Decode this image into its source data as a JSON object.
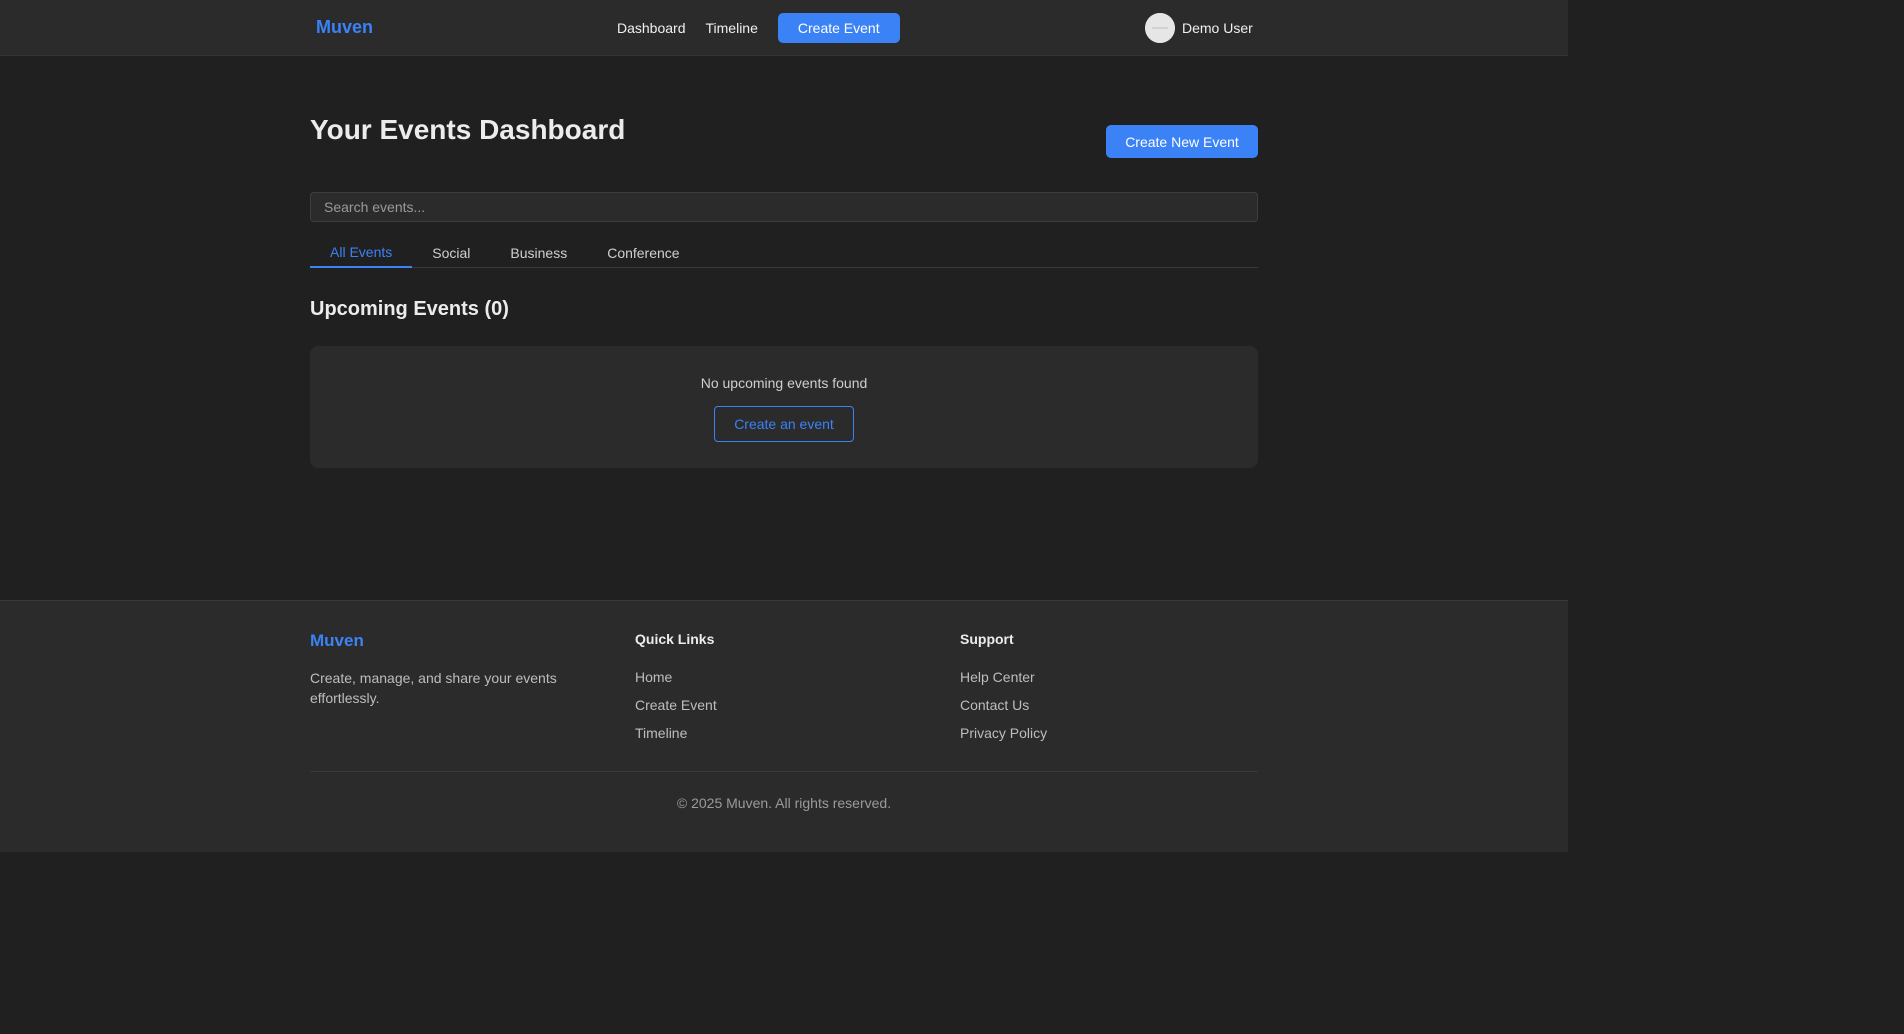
{
  "navbar": {
    "brand": "Muven",
    "links": [
      "Dashboard",
      "Timeline"
    ],
    "create_label": "Create Event",
    "user_name": "Demo User"
  },
  "main": {
    "title": "Your Events Dashboard",
    "create_new_label": "Create New Event",
    "search_placeholder": "Search events...",
    "tabs": [
      "All Events",
      "Social",
      "Business",
      "Conference"
    ],
    "active_tab": "All Events",
    "section_title": "Upcoming Events (0)",
    "empty_text": "No upcoming events found",
    "empty_action_label": "Create an event"
  },
  "footer": {
    "brand": "Muven",
    "description": "Create, manage, and share your events effortlessly.",
    "quick_links": {
      "heading": "Quick Links",
      "items": [
        "Home",
        "Create Event",
        "Timeline"
      ]
    },
    "support": {
      "heading": "Support",
      "items": [
        "Help Center",
        "Contact Us",
        "Privacy Policy"
      ]
    },
    "copyright": "© 2025 Muven. All rights reserved."
  },
  "colors": {
    "accent": "#3b82f6",
    "background": "#202020",
    "surface": "#2b2b2b"
  }
}
